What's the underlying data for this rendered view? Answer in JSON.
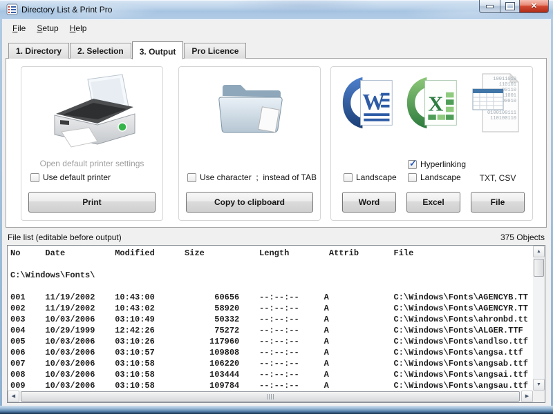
{
  "window": {
    "title": "Directory List & Print Pro"
  },
  "menu": {
    "items": [
      {
        "label": "File"
      },
      {
        "label": "Setup"
      },
      {
        "label": "Help"
      }
    ]
  },
  "tabs": [
    {
      "label": "1. Directory"
    },
    {
      "label": "2. Selection"
    },
    {
      "label": "3. Output"
    },
    {
      "label": "Pro Licence"
    }
  ],
  "active_tab": "3. Output",
  "panels": {
    "print": {
      "hint": "Open default printer settings",
      "checkbox_label": "Use default printer",
      "checkbox_checked": false,
      "button": "Print"
    },
    "clipboard": {
      "checkbox_label": "Use character  ;  instead of TAB",
      "checkbox_checked": false,
      "button": "Copy to clipboard"
    },
    "export": {
      "hyperlinking": {
        "label": "Hyperlinking",
        "checked": true
      },
      "word_landscape": {
        "label": "Landscape",
        "checked": false
      },
      "excel_landscape": {
        "label": "Landscape",
        "checked": false
      },
      "file_formats": "TXT, CSV",
      "buttons": {
        "word": "Word",
        "excel": "Excel",
        "file": "File"
      }
    }
  },
  "filelist": {
    "label": "File list (editable before output)",
    "count": "375 Objects",
    "columns": [
      "No",
      "Date",
      "Modified",
      "Size",
      "Length",
      "Attrib",
      "File"
    ],
    "path_line": "C:\\Windows\\Fonts\\",
    "rows": [
      [
        "001",
        "11/19/2002",
        "10:43:00",
        "60656",
        "--:--:--",
        "A",
        "C:\\Windows\\Fonts\\AGENCYB.TT"
      ],
      [
        "002",
        "11/19/2002",
        "10:43:02",
        "58920",
        "--:--:--",
        "A",
        "C:\\Windows\\Fonts\\AGENCYR.TT"
      ],
      [
        "003",
        "10/03/2006",
        "03:10:49",
        "50332",
        "--:--:--",
        "A",
        "C:\\Windows\\Fonts\\ahronbd.tt"
      ],
      [
        "004",
        "10/29/1999",
        "12:42:26",
        "75272",
        "--:--:--",
        "A",
        "C:\\Windows\\Fonts\\ALGER.TTF"
      ],
      [
        "005",
        "10/03/2006",
        "03:10:26",
        "117960",
        "--:--:--",
        "A",
        "C:\\Windows\\Fonts\\andlso.ttf"
      ],
      [
        "006",
        "10/03/2006",
        "03:10:57",
        "109808",
        "--:--:--",
        "A",
        "C:\\Windows\\Fonts\\angsa.ttf"
      ],
      [
        "007",
        "10/03/2006",
        "03:10:58",
        "106220",
        "--:--:--",
        "A",
        "C:\\Windows\\Fonts\\angsab.ttf"
      ],
      [
        "008",
        "10/03/2006",
        "03:10:58",
        "103444",
        "--:--:--",
        "A",
        "C:\\Windows\\Fonts\\angsai.ttf"
      ],
      [
        "009",
        "10/03/2006",
        "03:10:58",
        "109784",
        "--:--:--",
        "A",
        "C:\\Windows\\Fonts\\angsau.ttf"
      ]
    ]
  }
}
